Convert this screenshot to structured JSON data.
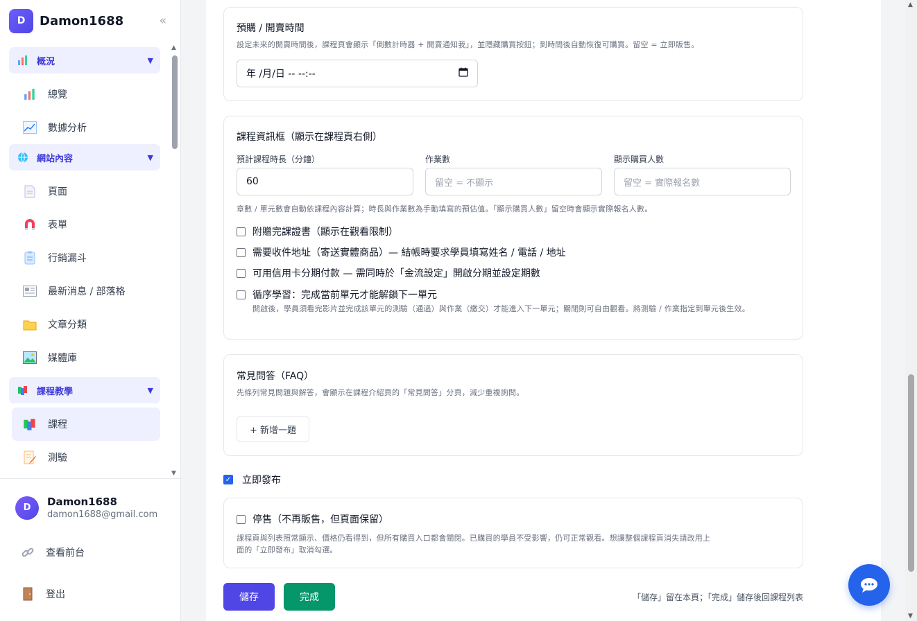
{
  "brand": {
    "avatar_letter": "D",
    "name": "Damon1688",
    "collapse_icon": "«"
  },
  "sidebar": {
    "groups": [
      {
        "label": "概況",
        "items": [
          "總覽",
          "數據分析"
        ]
      },
      {
        "label": "網站內容",
        "items": [
          "頁面",
          "表單",
          "行銷漏斗",
          "最新消息 / 部落格",
          "文章分類",
          "媒體庫"
        ]
      },
      {
        "label": "課程教學",
        "items": [
          "課程",
          "測驗"
        ]
      }
    ],
    "active_item": "課程",
    "caret": "▼"
  },
  "user": {
    "avatar_letter": "D",
    "name": "Damon1688",
    "email": "damon1688@gmail.com"
  },
  "footer_links": {
    "view_front": "查看前台",
    "logout": "登出"
  },
  "presale": {
    "title": "預購 / 開賣時間",
    "hint": "設定未來的開賣時間後，課程頁會顯示「倒數計時器 + 開賣通知我」，並隱藏購買按鈕；到時間後自動恢復可購買。留空 = 立即販售。",
    "datetime_value": "年 /月/日 -- --:--"
  },
  "info_box": {
    "title": "課程資訊框（顯示在課程頁右側）",
    "duration_label": "預計課程時長（分鐘）",
    "duration_value": "60",
    "homework_label": "作業數",
    "homework_placeholder": "留空 = 不顯示",
    "buyers_label": "顯示購買人數",
    "buyers_placeholder": "留空 = 實際報名數",
    "hint": "章數 / 單元數會自動依課程內容計算；時長與作業數為手動填寫的預估值。「顯示購買人數」留空時會顯示實際報名人數。",
    "options": [
      {
        "label": "附贈完課證書（顯示在觀看限制）",
        "checked": false
      },
      {
        "label": "需要收件地址（寄送實體商品）— 結帳時要求學員填寫姓名 / 電話 / 地址",
        "checked": false
      },
      {
        "label": "可用信用卡分期付款 — 需同時於「金流設定」開啟分期並設定期數",
        "checked": false
      },
      {
        "label": "循序學習：完成當前單元才能解鎖下一單元",
        "checked": false
      }
    ],
    "sequential_hint": "開啟後，學員須看完影片並完成該單元的測驗（通過）與作業（繳交）才能進入下一單元；關閉則可自由觀看。將測驗 / 作業指定到單元後生效。"
  },
  "faq": {
    "title": "常見問答（FAQ）",
    "hint": "先條列常見問題與解答，會顯示在課程介紹頁的「常見問答」分頁，減少重複詢問。",
    "add_button": "+ 新增一題"
  },
  "publish": {
    "label": "立即發布",
    "checked": true
  },
  "suspend": {
    "label": "停售（不再販售，但頁面保留）",
    "checked": false,
    "hint_line1": "課程頁與列表照常顯示、價格仍看得到，但所有購買入口都會關閉。已購買的學員不受影響，仍可正常觀看。想讓整個課程頁消失請改用上",
    "hint_line2": "面的「立即發布」取消勾選。"
  },
  "actions": {
    "save": "儲存",
    "done": "完成",
    "note": "「儲存」留在本頁；「完成」儲存後回課程列表"
  },
  "colors": {
    "accent": "#4f46e5",
    "success": "#059669",
    "checkbox": "#2563eb",
    "chat": "#2563eb"
  }
}
